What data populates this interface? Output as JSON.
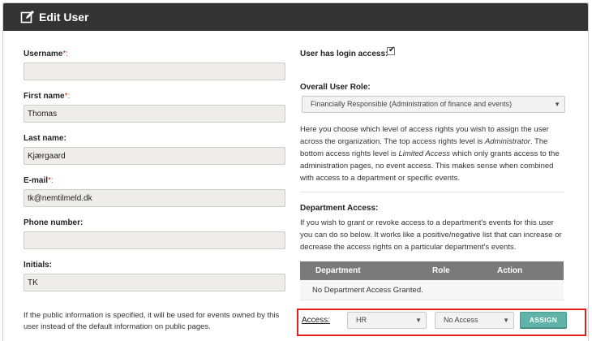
{
  "header": {
    "title": "Edit User",
    "icon": "edit-icon"
  },
  "form": {
    "username": {
      "label": "Username",
      "required_mark": "*:",
      "value": ""
    },
    "first_name": {
      "label": "First name",
      "required_mark": "*:",
      "value": "Thomas"
    },
    "last_name": {
      "label": "Last name:",
      "value": "Kjærgaard"
    },
    "email": {
      "label": "E-mail",
      "required_mark": "*:",
      "value": "tk@nemtilmeld.dk"
    },
    "phone": {
      "label": "Phone number:",
      "value": ""
    },
    "initials": {
      "label": "Initials:",
      "value": "TK"
    },
    "public_info_note": "If the public information is specified, it will be used for events owned by this user instead of the default information on public pages."
  },
  "access": {
    "login_label": "User has login access:",
    "login_checked": true,
    "role_label": "Overall User Role:",
    "role_selected": "Financially Responsible (Administration of finance and events)",
    "role_desc_1": "Here you choose which level of access rights you wish to assign the user across the organization. The top access rights level is ",
    "role_desc_top": "Administrator",
    "role_desc_2": ". The bottom access rights level is ",
    "role_desc_bottom": "Limited Access",
    "role_desc_3": " which only grants access to the administration pages, no event access. This makes sense when combined with access to a department or specific events.",
    "dept_label": "Department Access:",
    "dept_desc": "If you wish to grant or revoke access to a department's events for this user you can do so below. It works like a positive/negative list that can increase or decrease the access rights on a particular department's events.",
    "table": {
      "columns": [
        "Department",
        "Role",
        "Action"
      ],
      "empty_text": "No Department Access Granted."
    },
    "assign_row": {
      "label": "Access:",
      "department_selected": "HR",
      "access_selected": "No Access",
      "button": "ASSIGN"
    }
  },
  "colors": {
    "titlebar": "#333333",
    "assign_button": "#5fb3a8",
    "highlight": "#e02020",
    "required": "#c0392b"
  }
}
